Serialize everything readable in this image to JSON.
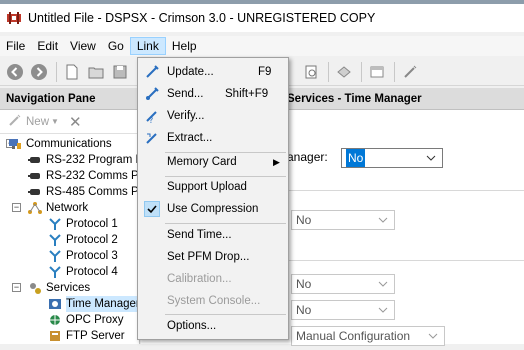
{
  "window": {
    "title": "Untitled File - DSPSX - Crimson 3.0 - UNREGISTERED COPY",
    "app_icon": "crimson-app-icon"
  },
  "menubar": {
    "items": [
      {
        "name": "file",
        "label": "File"
      },
      {
        "name": "edit",
        "label": "Edit"
      },
      {
        "name": "view",
        "label": "View"
      },
      {
        "name": "go",
        "label": "Go"
      },
      {
        "name": "link",
        "label": "Link"
      },
      {
        "name": "help",
        "label": "Help"
      }
    ],
    "active": "Link"
  },
  "toolbar": {
    "icons": [
      "back-icon",
      "forward-icon",
      "new-file-icon",
      "open-folder-icon",
      "save-icon",
      "print-preview-icon",
      "send-icon",
      "blocked-icon",
      "window-icon",
      "wand-icon"
    ]
  },
  "nav": {
    "title": "Navigation Pane",
    "new_label": "New",
    "tree": [
      {
        "label": "Communications",
        "icon": "communications-icon",
        "level": 0,
        "expanded": true
      },
      {
        "label": "RS-232 Program Port",
        "icon": "serial-port-icon",
        "level": 1
      },
      {
        "label": "RS-232 Comms Port",
        "icon": "serial-port-icon",
        "level": 1
      },
      {
        "label": "RS-485 Comms Port",
        "icon": "serial-port-icon",
        "level": 1
      },
      {
        "label": "Network",
        "icon": "network-icon",
        "level": 1,
        "expanded": true
      },
      {
        "label": "Protocol 1",
        "icon": "protocol-icon",
        "level": 2
      },
      {
        "label": "Protocol 2",
        "icon": "protocol-icon",
        "level": 2
      },
      {
        "label": "Protocol 3",
        "icon": "protocol-icon",
        "level": 2
      },
      {
        "label": "Protocol 4",
        "icon": "protocol-icon",
        "level": 2
      },
      {
        "label": "Services",
        "icon": "services-icon",
        "level": 1,
        "expanded": true
      },
      {
        "label": "Time Manager",
        "icon": "time-manager-icon",
        "level": 2,
        "selected": true
      },
      {
        "label": "OPC Proxy",
        "icon": "opc-proxy-icon",
        "level": 2
      },
      {
        "label": "FTP Server",
        "icon": "ftp-server-icon",
        "level": 2
      }
    ]
  },
  "content": {
    "header": "Services - Time Manager",
    "manager_label": "anager:",
    "manager_value": "No",
    "combo_values": [
      "No",
      "No",
      "No"
    ],
    "last_combo_value": "Manual Configuration"
  },
  "link_menu": {
    "items": [
      {
        "label": "Update...",
        "shortcut": "F9",
        "icon": "update-icon",
        "enabled": true
      },
      {
        "label": "Send...",
        "shortcut": "Shift+F9",
        "icon": "send-icon",
        "enabled": true
      },
      {
        "label": "Verify...",
        "shortcut": "",
        "icon": "verify-icon",
        "enabled": true
      },
      {
        "label": "Extract...",
        "shortcut": "",
        "icon": "extract-icon",
        "enabled": true
      },
      {
        "type": "separator"
      },
      {
        "label": "Memory Card",
        "shortcut": "",
        "icon": "",
        "enabled": true,
        "submenu": true
      },
      {
        "type": "separator"
      },
      {
        "label": "Support Upload",
        "shortcut": "",
        "icon": "",
        "enabled": true
      },
      {
        "label": "Use Compression",
        "shortcut": "",
        "icon": "checkmark-icon",
        "enabled": true,
        "checked": true
      },
      {
        "type": "separator"
      },
      {
        "label": "Send Time...",
        "shortcut": "",
        "icon": "",
        "enabled": true
      },
      {
        "label": "Set PFM Drop...",
        "shortcut": "",
        "icon": "",
        "enabled": true
      },
      {
        "label": "Calibration...",
        "shortcut": "",
        "icon": "",
        "enabled": false
      },
      {
        "label": "System Console...",
        "shortcut": "",
        "icon": "",
        "enabled": false
      },
      {
        "type": "separator"
      },
      {
        "label": "Options...",
        "shortcut": "",
        "icon": "",
        "enabled": true
      }
    ]
  },
  "colors": {
    "accent": "#0078d7",
    "menu_highlight": "#cce8ff",
    "disabled_text": "#9b9b9b"
  }
}
